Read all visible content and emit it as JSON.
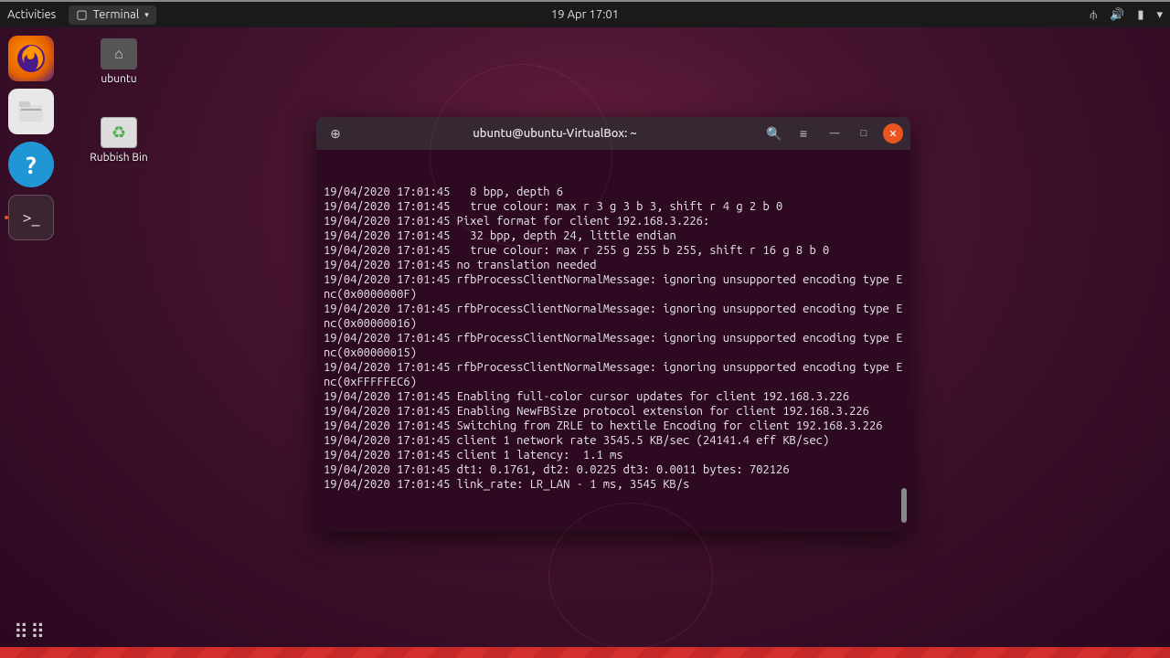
{
  "topbar": {
    "activities": "Activities",
    "app_name": "Terminal",
    "datetime": "19 Apr  17:01"
  },
  "desktop": {
    "home_label": "ubuntu",
    "trash_label": "Rubbish Bin"
  },
  "terminal": {
    "title": "ubuntu@ubuntu-VirtualBox: ~",
    "lines": [
      "19/04/2020 17:01:45   8 bpp, depth 6",
      "19/04/2020 17:01:45   true colour: max r 3 g 3 b 3, shift r 4 g 2 b 0",
      "19/04/2020 17:01:45 Pixel format for client 192.168.3.226:",
      "19/04/2020 17:01:45   32 bpp, depth 24, little endian",
      "19/04/2020 17:01:45   true colour: max r 255 g 255 b 255, shift r 16 g 8 b 0",
      "19/04/2020 17:01:45 no translation needed",
      "19/04/2020 17:01:45 rfbProcessClientNormalMessage: ignoring unsupported encoding type Enc(0x0000000F)",
      "19/04/2020 17:01:45 rfbProcessClientNormalMessage: ignoring unsupported encoding type Enc(0x00000016)",
      "19/04/2020 17:01:45 rfbProcessClientNormalMessage: ignoring unsupported encoding type Enc(0x00000015)",
      "19/04/2020 17:01:45 rfbProcessClientNormalMessage: ignoring unsupported encoding type Enc(0xFFFFFEC6)",
      "19/04/2020 17:01:45 Enabling full-color cursor updates for client 192.168.3.226",
      "19/04/2020 17:01:45 Enabling NewFBSize protocol extension for client 192.168.3.226",
      "19/04/2020 17:01:45 Switching from ZRLE to hextile Encoding for client 192.168.3.226",
      "19/04/2020 17:01:45 client 1 network rate 3545.5 KB/sec (24141.4 eff KB/sec)",
      "19/04/2020 17:01:45 client 1 latency:  1.1 ms",
      "19/04/2020 17:01:45 dt1: 0.1761, dt2: 0.0225 dt3: 0.0011 bytes: 702126",
      "19/04/2020 17:01:45 link_rate: LR_LAN - 1 ms, 3545 KB/s"
    ]
  }
}
